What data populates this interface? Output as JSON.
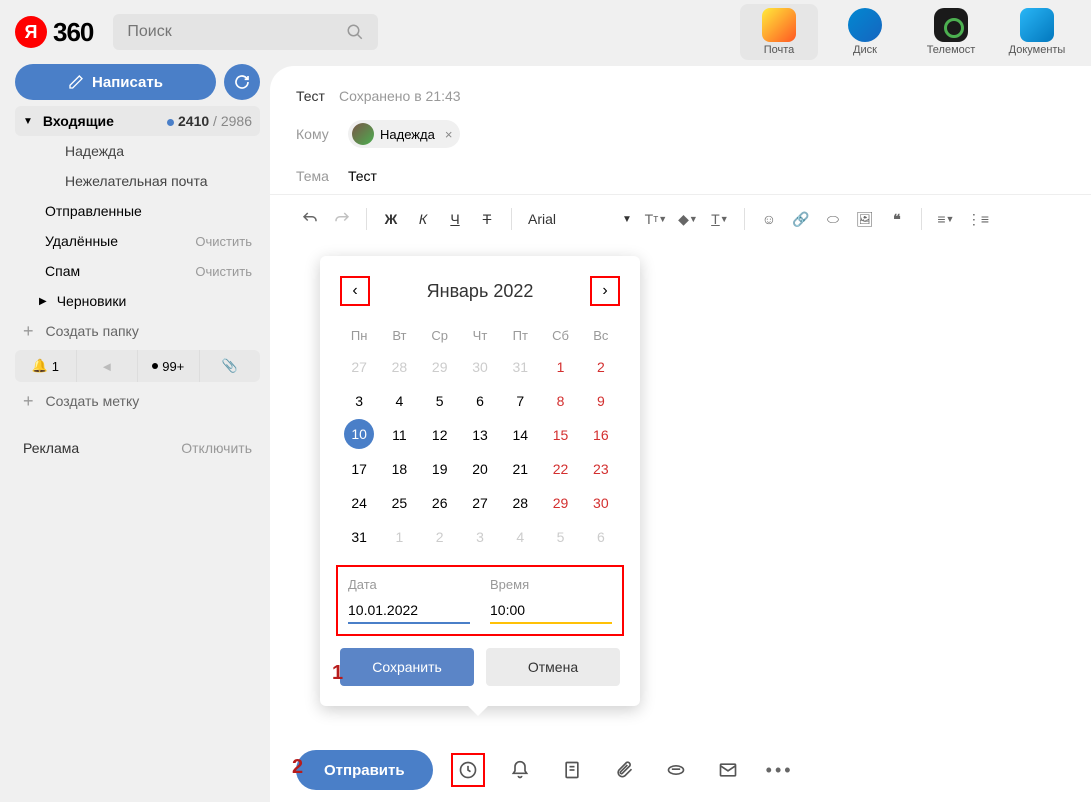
{
  "header": {
    "logo_text": "360",
    "logo_y": "Я",
    "search_placeholder": "Поиск",
    "apps": [
      {
        "label": "Почта",
        "active": true
      },
      {
        "label": "Диск"
      },
      {
        "label": "Телемост"
      },
      {
        "label": "Документы"
      }
    ]
  },
  "sidebar": {
    "compose": "Написать",
    "folders": {
      "inbox": {
        "name": "Входящие",
        "unread": "2410",
        "total": "2986"
      },
      "sub1": "Надежда",
      "sub2": "Нежелательная почта",
      "sent": "Отправленные",
      "deleted": {
        "name": "Удалённые",
        "action": "Очистить"
      },
      "spam": {
        "name": "Спам",
        "action": "Очистить"
      },
      "drafts": "Черновики",
      "create_folder": "Создать папку",
      "create_label": "Создать метку"
    },
    "status": {
      "bell": "1",
      "count": "99+"
    },
    "ad": {
      "label": "Реклама",
      "off": "Отключить"
    }
  },
  "compose": {
    "subject_short": "Тест",
    "saved": "Сохранено в 21:43",
    "to_label": "Кому",
    "recipient": "Надежда",
    "subject_label": "Тема",
    "subject": "Тест",
    "toolbar": {
      "bold": "Ж",
      "italic": "К",
      "underline": "Ч",
      "strike": "Т",
      "font": "Arial"
    }
  },
  "calendar": {
    "title": "Январь 2022",
    "dow": [
      "Пн",
      "Вт",
      "Ср",
      "Чт",
      "Пт",
      "Сб",
      "Вс"
    ],
    "weeks": [
      [
        {
          "d": "27",
          "o": true
        },
        {
          "d": "28",
          "o": true
        },
        {
          "d": "29",
          "o": true
        },
        {
          "d": "30",
          "o": true
        },
        {
          "d": "31",
          "o": true
        },
        {
          "d": "1",
          "w": true
        },
        {
          "d": "2",
          "w": true
        }
      ],
      [
        {
          "d": "3"
        },
        {
          "d": "4"
        },
        {
          "d": "5"
        },
        {
          "d": "6"
        },
        {
          "d": "7"
        },
        {
          "d": "8",
          "w": true
        },
        {
          "d": "9",
          "w": true
        }
      ],
      [
        {
          "d": "10",
          "sel": true
        },
        {
          "d": "11"
        },
        {
          "d": "12"
        },
        {
          "d": "13"
        },
        {
          "d": "14"
        },
        {
          "d": "15",
          "w": true
        },
        {
          "d": "16",
          "w": true
        }
      ],
      [
        {
          "d": "17"
        },
        {
          "d": "18"
        },
        {
          "d": "19"
        },
        {
          "d": "20"
        },
        {
          "d": "21"
        },
        {
          "d": "22",
          "w": true
        },
        {
          "d": "23",
          "w": true
        }
      ],
      [
        {
          "d": "24"
        },
        {
          "d": "25"
        },
        {
          "d": "26"
        },
        {
          "d": "27"
        },
        {
          "d": "28"
        },
        {
          "d": "29",
          "w": true
        },
        {
          "d": "30",
          "w": true
        }
      ],
      [
        {
          "d": "31"
        },
        {
          "d": "1",
          "o": true
        },
        {
          "d": "2",
          "o": true
        },
        {
          "d": "3",
          "o": true
        },
        {
          "d": "4",
          "o": true
        },
        {
          "d": "5",
          "o": true
        },
        {
          "d": "6",
          "o": true
        }
      ]
    ],
    "date_label": "Дата",
    "time_label": "Время",
    "date_value": "10.01.2022",
    "time_value": "10:00",
    "save": "Сохранить",
    "cancel": "Отмена"
  },
  "actions": {
    "send": "Отправить"
  },
  "markers": {
    "m1": "1",
    "m2": "2"
  }
}
